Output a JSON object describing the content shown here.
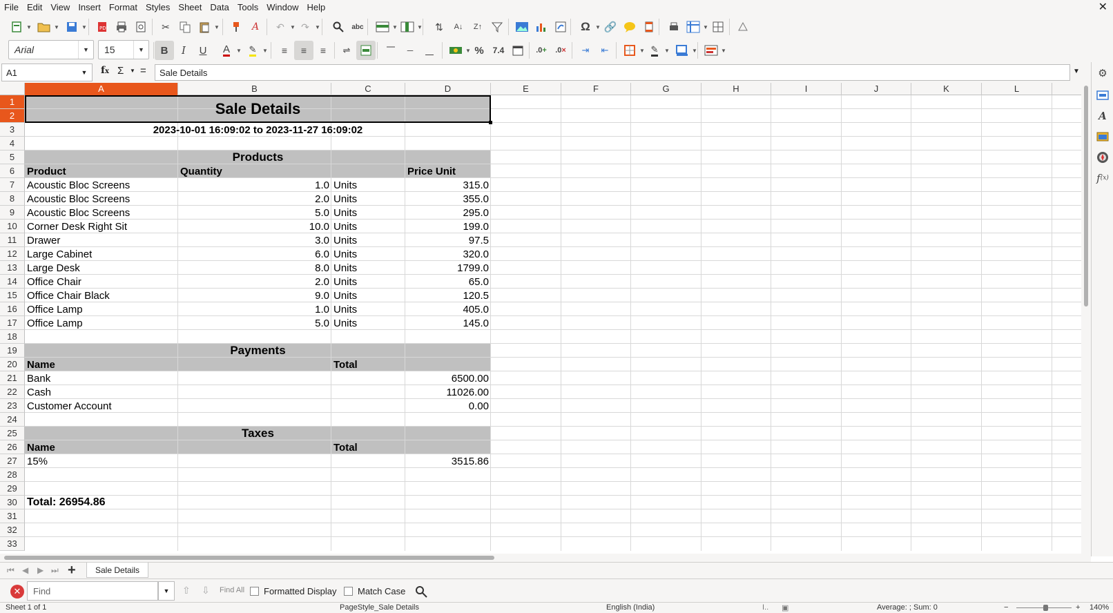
{
  "menu": [
    "File",
    "Edit",
    "View",
    "Insert",
    "Format",
    "Styles",
    "Sheet",
    "Data",
    "Tools",
    "Window",
    "Help"
  ],
  "toolbar": {
    "font_name": "Arial",
    "font_size": "15",
    "number_format_label": "7.4"
  },
  "formula_bar": {
    "cell_ref": "A1",
    "content": "Sale Details"
  },
  "columns": [
    "A",
    "B",
    "C",
    "D",
    "E",
    "F",
    "G",
    "H",
    "I",
    "J",
    "K",
    "L"
  ],
  "rows": [
    "1",
    "2",
    "3",
    "4",
    "5",
    "6",
    "7",
    "8",
    "9",
    "10",
    "11",
    "12",
    "13",
    "14",
    "15",
    "16",
    "17",
    "18",
    "19",
    "20",
    "21",
    "22",
    "23",
    "24",
    "25",
    "26",
    "27",
    "28",
    "29",
    "30",
    "31",
    "32",
    "33"
  ],
  "sheet": {
    "title": "Sale Details",
    "date_range": "2023-10-01 16:09:02 to 2023-11-27 16:09:02",
    "products_header": "Products",
    "product_cols": {
      "product": "Product",
      "quantity": "Quantity",
      "price_unit": "Price Unit"
    },
    "products": [
      {
        "name": "Acoustic Bloc Screens",
        "qty": "1.0",
        "unit": "Units",
        "price": "315.0"
      },
      {
        "name": "Acoustic Bloc Screens",
        "qty": "2.0",
        "unit": "Units",
        "price": "355.0"
      },
      {
        "name": "Acoustic Bloc Screens",
        "qty": "5.0",
        "unit": "Units",
        "price": "295.0"
      },
      {
        "name": "Corner Desk Right Sit",
        "qty": "10.0",
        "unit": "Units",
        "price": "199.0"
      },
      {
        "name": "Drawer",
        "qty": "3.0",
        "unit": "Units",
        "price": "97.5"
      },
      {
        "name": "Large Cabinet",
        "qty": "6.0",
        "unit": "Units",
        "price": "320.0"
      },
      {
        "name": "Large Desk",
        "qty": "8.0",
        "unit": "Units",
        "price": "1799.0"
      },
      {
        "name": "Office Chair",
        "qty": "2.0",
        "unit": "Units",
        "price": "65.0"
      },
      {
        "name": "Office Chair Black",
        "qty": "9.0",
        "unit": "Units",
        "price": "120.5"
      },
      {
        "name": "Office Lamp",
        "qty": "1.0",
        "unit": "Units",
        "price": "405.0"
      },
      {
        "name": "Office Lamp",
        "qty": "5.0",
        "unit": "Units",
        "price": "145.0"
      }
    ],
    "payments_header": "Payments",
    "payment_cols": {
      "name": "Name",
      "total": "Total"
    },
    "payments": [
      {
        "name": "Bank",
        "total": "6500.00"
      },
      {
        "name": "Cash",
        "total": "11026.00"
      },
      {
        "name": "Customer Account",
        "total": "0.00"
      }
    ],
    "taxes_header": "Taxes",
    "tax_cols": {
      "name": "Name",
      "total": "Total"
    },
    "taxes": [
      {
        "name": "15%",
        "total": "3515.86"
      }
    ],
    "total_line": "Total:  26954.86"
  },
  "sheet_tab": "Sale Details",
  "find_bar": {
    "placeholder": "Find",
    "find_all": "Find All",
    "formatted_display": "Formatted Display",
    "match_case": "Match Case"
  },
  "status": {
    "sheet": "Sheet 1 of 1",
    "page_style": "PageStyle_Sale Details",
    "language": "English (India)",
    "summary": "Average: ; Sum: 0",
    "zoom": "140%"
  },
  "colors": {
    "accent": "#e8571c",
    "section_fill": "#c0c0c0",
    "chrome": "#f6f5f4"
  }
}
